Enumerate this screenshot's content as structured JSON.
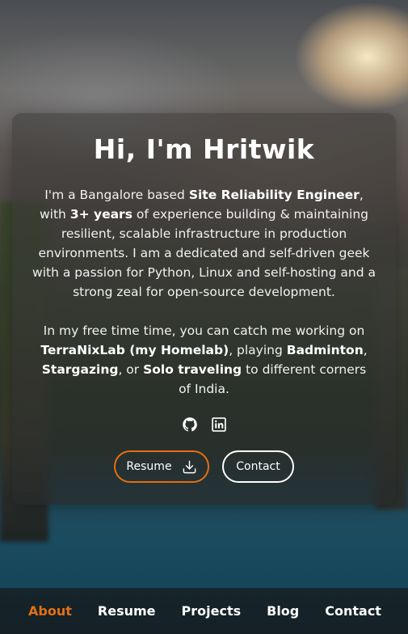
{
  "hero": {
    "title": "Hi, I'm Hritwik",
    "intro": {
      "t1": "I'm a Bangalore based ",
      "b1": "Site Reliability Engineer",
      "t2": ", with ",
      "b2": "3+ years",
      "t3": " of experience building & maintaining resilient, scalable infrastructure in production environments. I am a dedicated and self-driven geek with a passion for Python, Linux and self-hosting and a strong zeal for open-source development."
    },
    "hobbies": {
      "t1": "In my free time time, you can catch me working on ",
      "b1": "TerraNixLab (my Homelab)",
      "t2": ", playing ",
      "b2": "Badminton",
      "t3": ", ",
      "b3": "Stargazing",
      "t4": ", or ",
      "b4": "Solo traveling",
      "t5": " to different corners of India."
    }
  },
  "socials": [
    {
      "icon": "github-icon"
    },
    {
      "icon": "linkedin-icon"
    }
  ],
  "buttons": {
    "resume_label": "Resume",
    "contact_label": "Contact"
  },
  "nav": {
    "items": [
      {
        "label": "About",
        "active": true
      },
      {
        "label": "Resume",
        "active": false
      },
      {
        "label": "Projects",
        "active": false
      },
      {
        "label": "Blog",
        "active": false
      },
      {
        "label": "Contact",
        "active": false
      }
    ]
  },
  "colors": {
    "accent": "#e46f12",
    "text": "#ffffff",
    "navbar_bg": "#162024"
  }
}
